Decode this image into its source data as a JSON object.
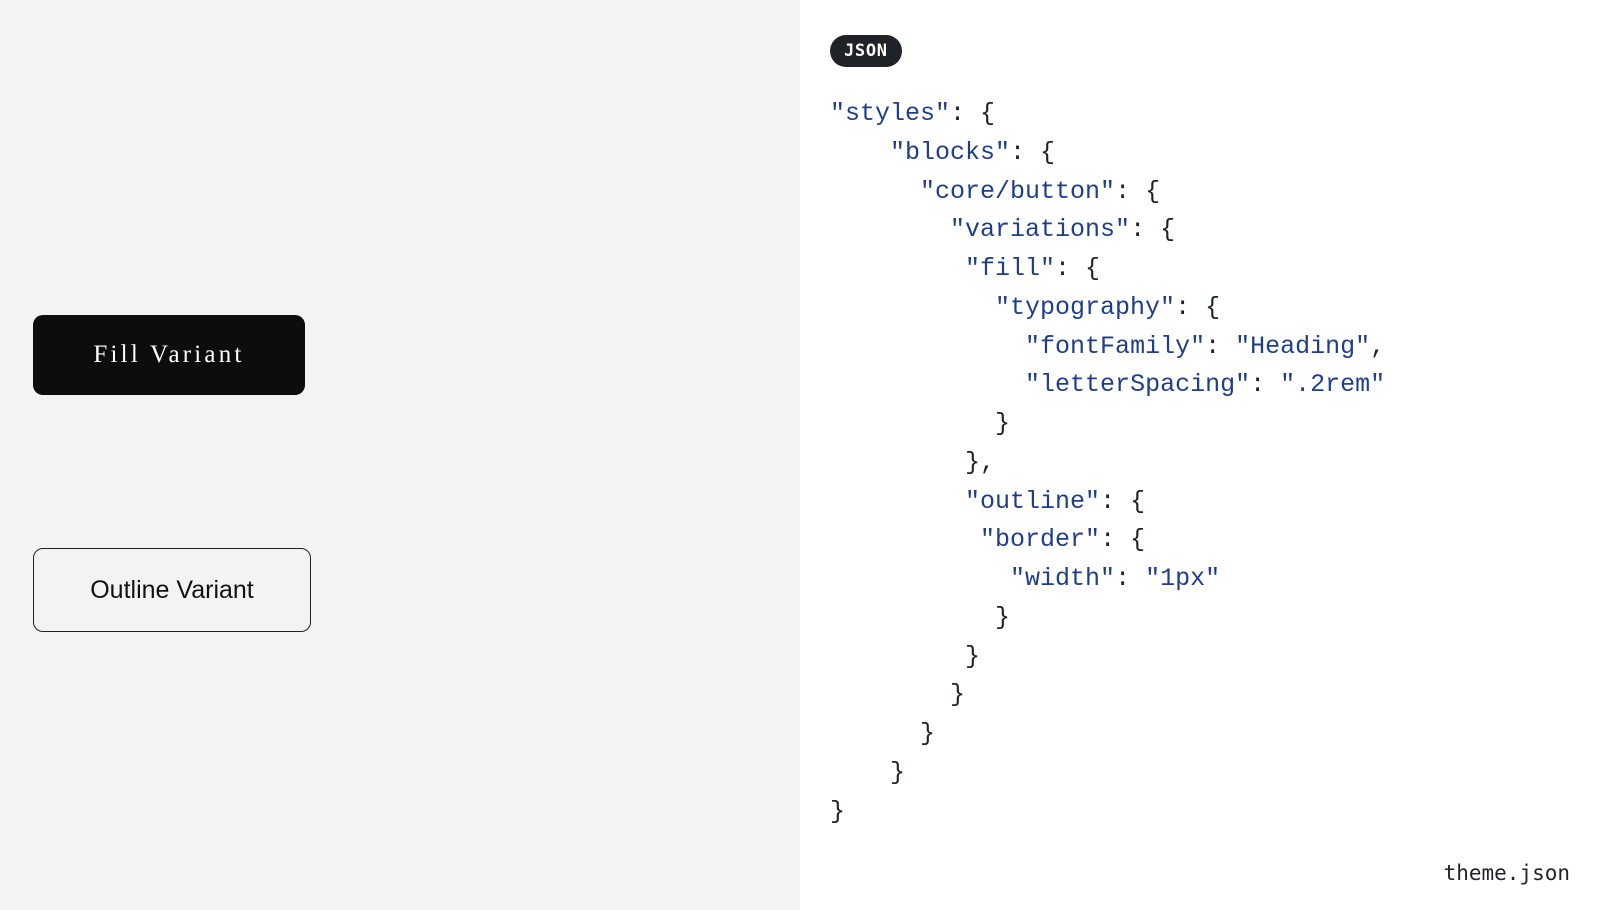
{
  "buttons": {
    "fill_label": "Fill Variant",
    "outline_label": "Outline Variant"
  },
  "code_panel": {
    "badge": "JSON",
    "filename": "theme.json",
    "tokens": [
      {
        "t": "k",
        "s": "\"styles\""
      },
      {
        "t": "p",
        "s": ": {\n"
      },
      {
        "t": "p",
        "s": "    "
      },
      {
        "t": "k",
        "s": "\"blocks\""
      },
      {
        "t": "p",
        "s": ": {\n"
      },
      {
        "t": "p",
        "s": "      "
      },
      {
        "t": "k",
        "s": "\"core/button\""
      },
      {
        "t": "p",
        "s": ": {\n"
      },
      {
        "t": "p",
        "s": "        "
      },
      {
        "t": "k",
        "s": "\"variations\""
      },
      {
        "t": "p",
        "s": ": {\n"
      },
      {
        "t": "p",
        "s": "         "
      },
      {
        "t": "k",
        "s": "\"fill\""
      },
      {
        "t": "p",
        "s": ": {\n"
      },
      {
        "t": "p",
        "s": "           "
      },
      {
        "t": "k",
        "s": "\"typography\""
      },
      {
        "t": "p",
        "s": ": {\n"
      },
      {
        "t": "p",
        "s": "             "
      },
      {
        "t": "k",
        "s": "\"fontFamily\""
      },
      {
        "t": "p",
        "s": ": "
      },
      {
        "t": "v",
        "s": "\"Heading\""
      },
      {
        "t": "p",
        "s": ",\n"
      },
      {
        "t": "p",
        "s": "             "
      },
      {
        "t": "k",
        "s": "\"letterSpacing\""
      },
      {
        "t": "p",
        "s": ": "
      },
      {
        "t": "v",
        "s": "\".2rem\""
      },
      {
        "t": "p",
        "s": "\n"
      },
      {
        "t": "p",
        "s": "           }\n"
      },
      {
        "t": "p",
        "s": "         },\n"
      },
      {
        "t": "p",
        "s": "         "
      },
      {
        "t": "k",
        "s": "\"outline\""
      },
      {
        "t": "p",
        "s": ": {\n"
      },
      {
        "t": "p",
        "s": "          "
      },
      {
        "t": "k",
        "s": "\"border\""
      },
      {
        "t": "p",
        "s": ": {\n"
      },
      {
        "t": "p",
        "s": "            "
      },
      {
        "t": "k",
        "s": "\"width\""
      },
      {
        "t": "p",
        "s": ": "
      },
      {
        "t": "v",
        "s": "\"1px\""
      },
      {
        "t": "p",
        "s": "\n"
      },
      {
        "t": "p",
        "s": "           }\n"
      },
      {
        "t": "p",
        "s": "         }\n"
      },
      {
        "t": "p",
        "s": "        }\n"
      },
      {
        "t": "p",
        "s": "      }\n"
      },
      {
        "t": "p",
        "s": "    }\n"
      },
      {
        "t": "p",
        "s": "}"
      }
    ]
  }
}
